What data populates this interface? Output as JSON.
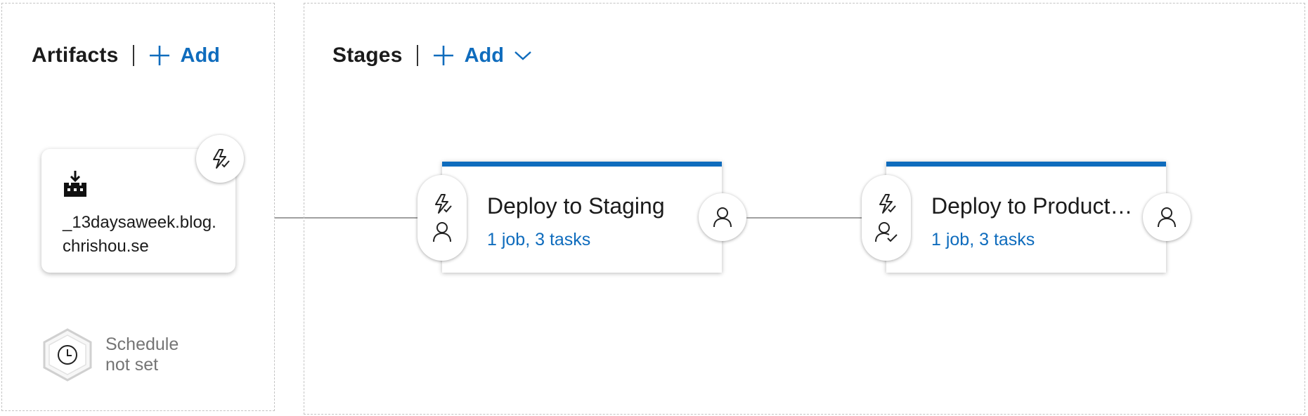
{
  "artifacts": {
    "title": "Artifacts",
    "add_label": "Add",
    "artifact_name": "_13daysaweek.blog.chrishou.se",
    "artifact_icon": "build-artifact-icon",
    "trigger_icon": "continuous-deployment-trigger-icon",
    "schedule": {
      "line1": "Schedule",
      "line2": "not set",
      "icon": "clock-icon"
    }
  },
  "stages": {
    "title": "Stages",
    "add_label": "Add",
    "items": [
      {
        "name": "Deploy to Staging",
        "summary": "1 job, 3 tasks",
        "pre_condition_icons": [
          "lightning-icon",
          "person-icon"
        ],
        "post_icon": "person-icon"
      },
      {
        "name": "Deploy to Production",
        "summary": "1 job, 3 tasks",
        "pre_condition_icons": [
          "lightning-icon",
          "person-check-icon"
        ],
        "post_icon": "person-icon"
      }
    ]
  },
  "colors": {
    "accent": "#0f6cbd",
    "text": "#1b1b1b",
    "muted": "#757575",
    "border": "#c4c4c4"
  }
}
